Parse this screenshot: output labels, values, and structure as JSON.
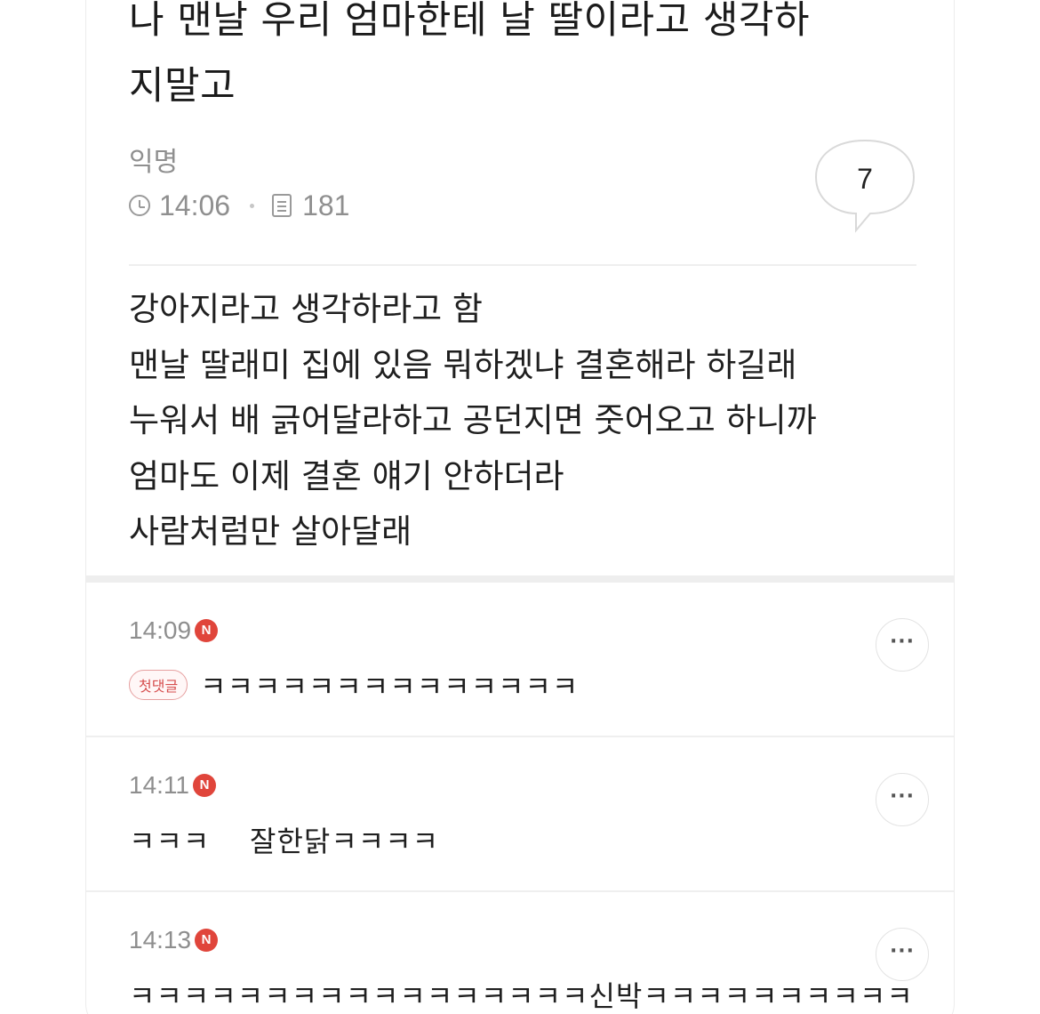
{
  "post": {
    "title_line1": "나 맨날 우리 엄마한테 날 딸이라고 생각하",
    "title_line2": "지말고",
    "author": "익명",
    "time": "14:06",
    "views": "181",
    "comment_count": "7",
    "body": [
      "강아지라고 생각하라고 함",
      "맨날 딸래미 집에 있음 뭐하겠냐 결혼해라 하길래",
      "누워서 배 긁어달라하고 공던지면 줏어오고 하니까",
      "엄마도 이제 결혼 얘기 안하더라",
      "사람처럼만 살아달래"
    ]
  },
  "comments": [
    {
      "time": "14:09",
      "badge": "N",
      "tag": "첫댓글",
      "text": "ㅋㅋㅋㅋㅋㅋㅋㅋㅋㅋㅋㅋㅋㅋ",
      "more": "···"
    },
    {
      "time": "14:11",
      "badge": "N",
      "text": "ㅋㅋㅋ    잘한닭ㅋㅋㅋㅋ",
      "more": "···"
    },
    {
      "time": "14:13",
      "badge": "N",
      "text": "ㅋㅋㅋㅋㅋㅋㅋㅋㅋㅋㅋㅋㅋㅋㅋㅋㅋ신박ㅋㅋㅋㅋㅋㅋㅋㅋㅋㅋ",
      "more": "···"
    }
  ],
  "icons": {
    "clock": "clock-icon",
    "views": "document-icon",
    "comments": "speech-bubble-icon",
    "more": "more-dots-icon"
  },
  "colors": {
    "new_badge": "#e0453b",
    "first_badge_border": "#e6a0a0",
    "first_badge_text": "#d64e4e",
    "meta_text": "#8f8f8f"
  }
}
